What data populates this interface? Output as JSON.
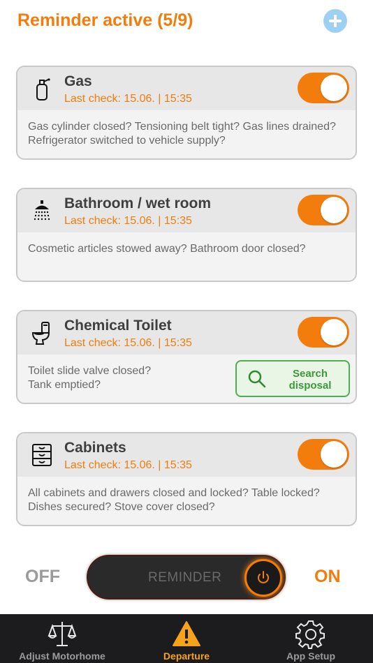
{
  "header": {
    "title": "Reminder active (5/9)",
    "add_icon": "plus-circle-icon"
  },
  "cards": [
    {
      "title": "Gas",
      "last_check": "Last check: 15.06. | 15:35",
      "description": "Gas cylinder closed? Tensioning belt tight? Gas lines drained? Refrigerator switched to vehicle supply?",
      "icon": "gas-cylinder-icon",
      "enabled": true
    },
    {
      "title": "Bathroom / wet room",
      "last_check": "Last check: 15.06. | 15:35",
      "description": "Cosmetic articles stowed away? Bathroom door closed?",
      "icon": "shower-icon",
      "enabled": true
    },
    {
      "title": "Chemical Toilet",
      "last_check": "Last check: 15.06. | 15:35",
      "description": "Toilet slide valve closed?\nTank emptied?",
      "icon": "toilet-icon",
      "enabled": true,
      "action_label_1": "Search",
      "action_label_2": "disposal"
    },
    {
      "title": "Cabinets",
      "last_check": "Last check: 15.06. | 15:35",
      "description": "All cabinets and drawers closed and locked? Table locked? Dishes secured? Stove cover closed?",
      "icon": "cabinet-icon",
      "enabled": true
    }
  ],
  "reminder": {
    "off_label": "OFF",
    "on_label": "ON",
    "slider_label": "REMINDER",
    "state": "on"
  },
  "tabs": [
    {
      "label": "Adjust Motorhome",
      "icon": "scales-icon",
      "active": false
    },
    {
      "label": "Departure",
      "icon": "warning-icon",
      "active": true
    },
    {
      "label": "App Setup",
      "icon": "gear-icon",
      "active": false
    }
  ],
  "colors": {
    "accent": "#f27d0c",
    "success": "#4caf50",
    "tabbar": "#1c1c1e",
    "tab_active": "#f7a21b"
  }
}
